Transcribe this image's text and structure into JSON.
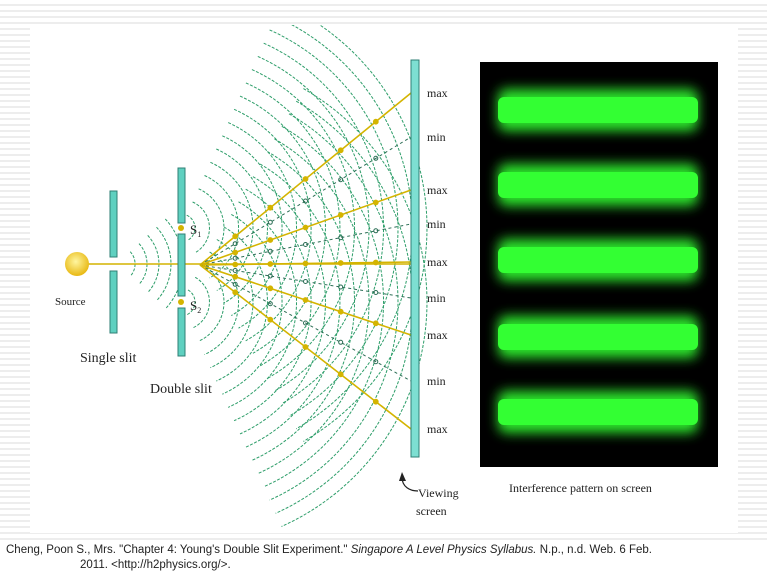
{
  "diagram": {
    "source_label": "Source",
    "single_slit_label": "Single slit",
    "double_slit_label": "Double slit",
    "s1_label": "S",
    "s1_sub": "1",
    "s2_label": "S",
    "s2_sub": "2",
    "viewing_screen_label_1": "Viewing",
    "viewing_screen_label_2": "screen",
    "fringe_labels": [
      "max",
      "min",
      "max",
      "min",
      "max",
      "min",
      "max",
      "min",
      "max"
    ],
    "pattern_caption": "Interference pattern on screen",
    "fringe_count": 5,
    "colors": {
      "wave_line": "#2e9e6a",
      "path_line": "#d4b400",
      "slit_fill": "#5fd0c0",
      "source": "#f2c81e",
      "fringe": "#33ff33",
      "pattern_bg": "#000000"
    }
  },
  "citation": {
    "line1_pre": "Cheng, Poon S., Mrs. \"Chapter 4: Young's Double Slit Experiment.\" ",
    "line1_italic": "Singapore A Level Physics Syllabus.",
    "line1_post": " N.p., n.d. Web. 6 Feb.",
    "line2": "2011. <http://h2physics.org/>."
  }
}
